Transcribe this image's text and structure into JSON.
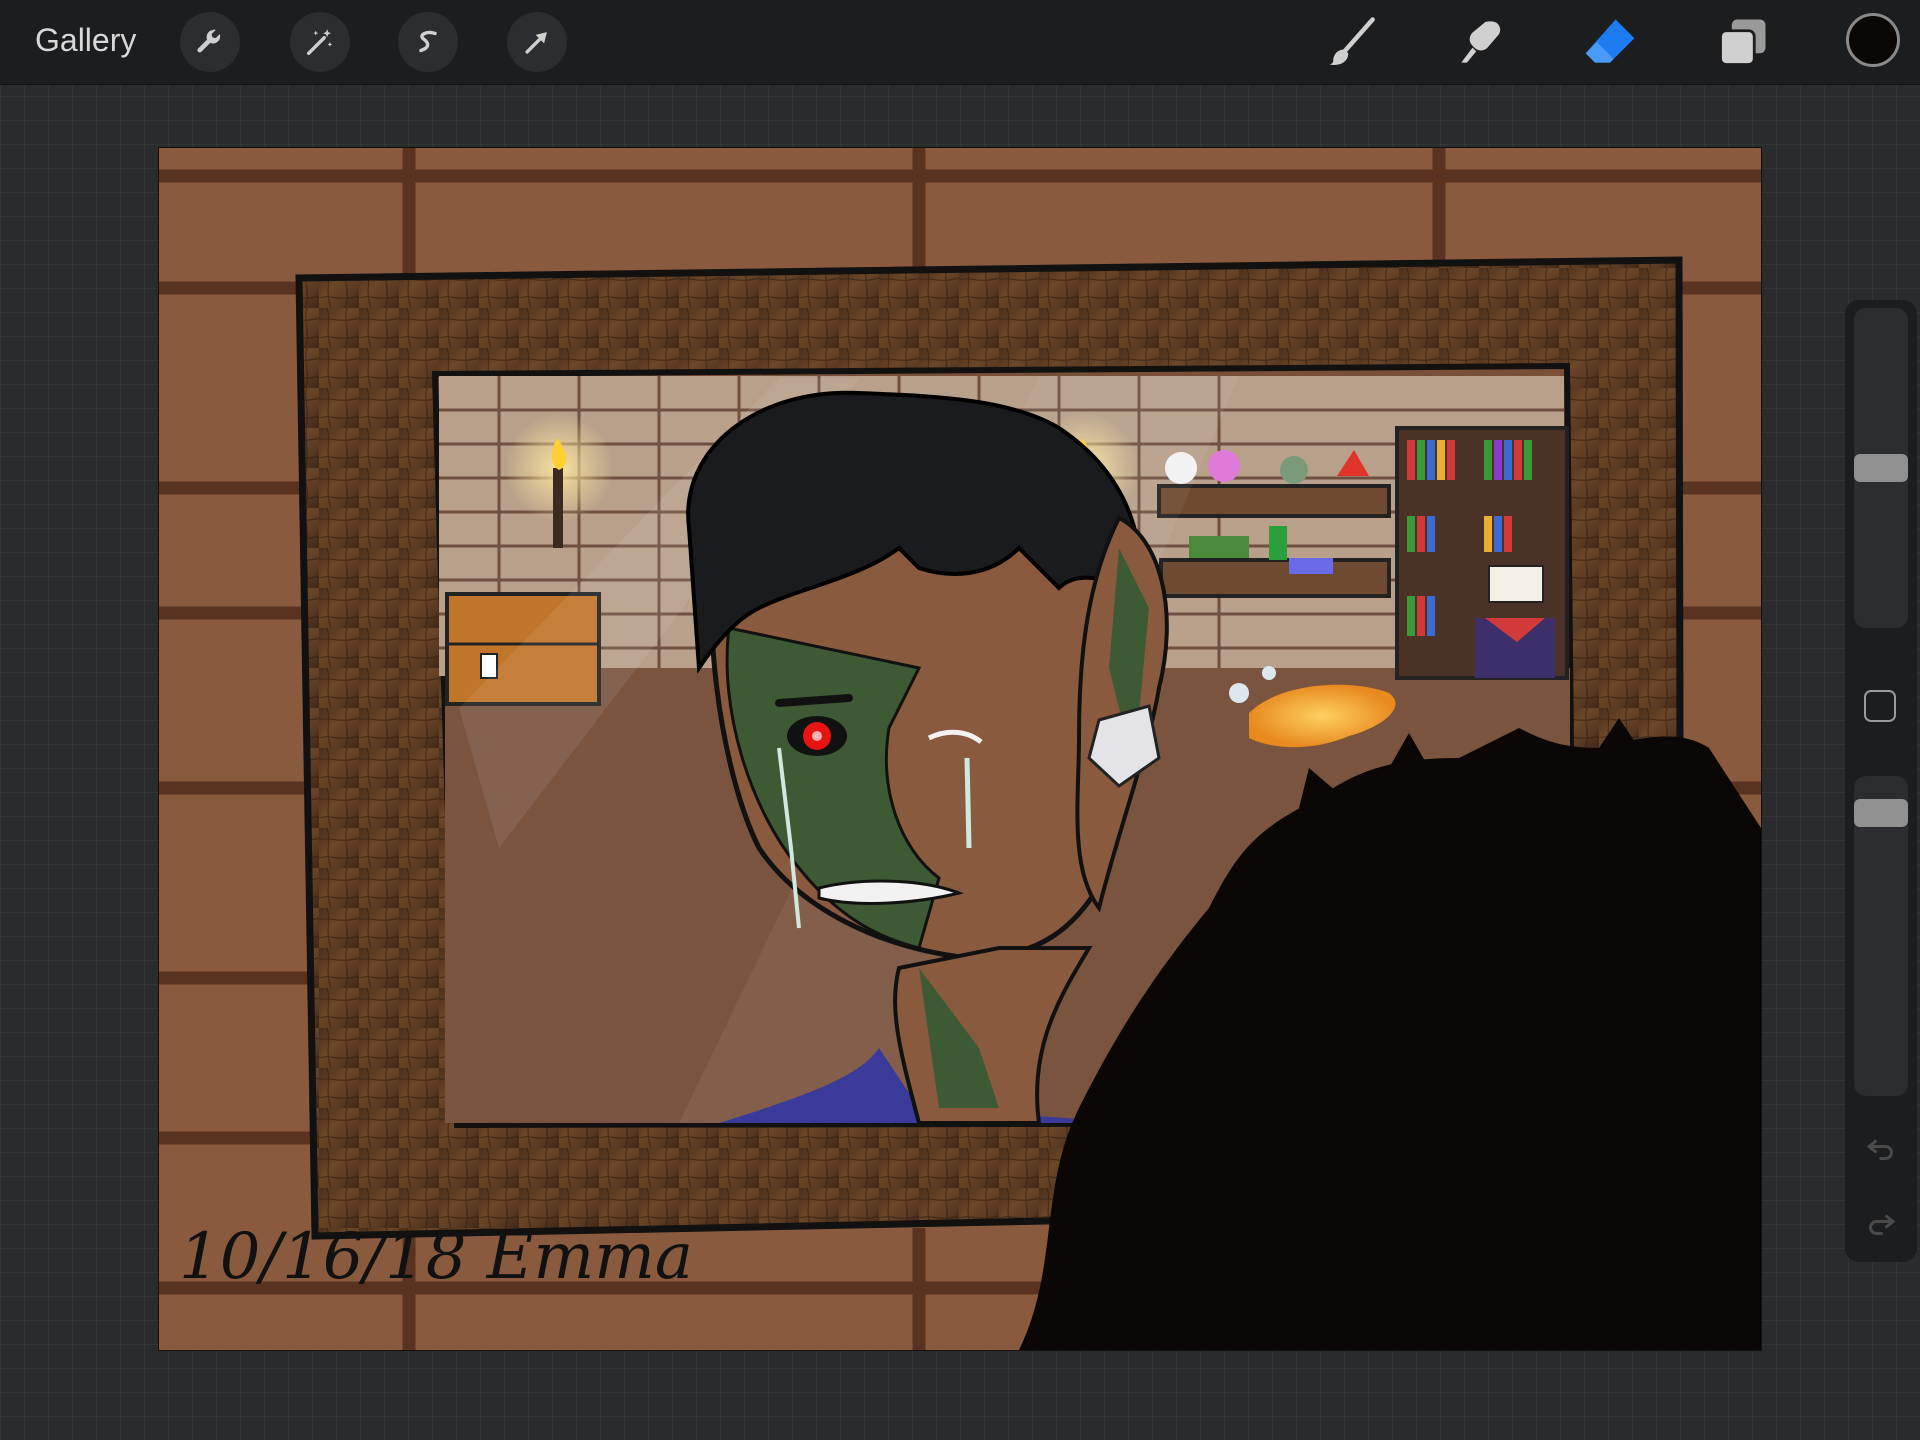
{
  "app": {
    "gallery_label": "Gallery"
  },
  "toolbar": {
    "actions": [
      {
        "name": "wrench-icon",
        "label": "Actions"
      },
      {
        "name": "magic-wand-icon",
        "label": "Adjustments"
      },
      {
        "name": "selection-icon",
        "label": "Selection"
      },
      {
        "name": "arrow-cursor-icon",
        "label": "Transform"
      }
    ],
    "tools": [
      {
        "name": "brush-icon",
        "active": false
      },
      {
        "name": "smudge-icon",
        "active": false
      },
      {
        "name": "eraser-icon",
        "active": true
      },
      {
        "name": "layers-icon",
        "active": false
      }
    ],
    "active_color": "#0b0706",
    "accent_color": "#1e7cf2"
  },
  "sidebar": {
    "brush_size_level": 0.5,
    "opacity_level": 0.08,
    "modify_button": "square-icon",
    "undo": "undo-icon",
    "redo": "redo-icon"
  },
  "artwork": {
    "signature": "10/16/18 Emma",
    "palette": {
      "wall": "#8a5a3e",
      "wall_lines": "#5a3320",
      "frame": "#5c3b22",
      "skin": "#8a5a3e",
      "zombie": "#3e5a34",
      "hair": "#0b0706",
      "eye": "#e81414"
    }
  }
}
